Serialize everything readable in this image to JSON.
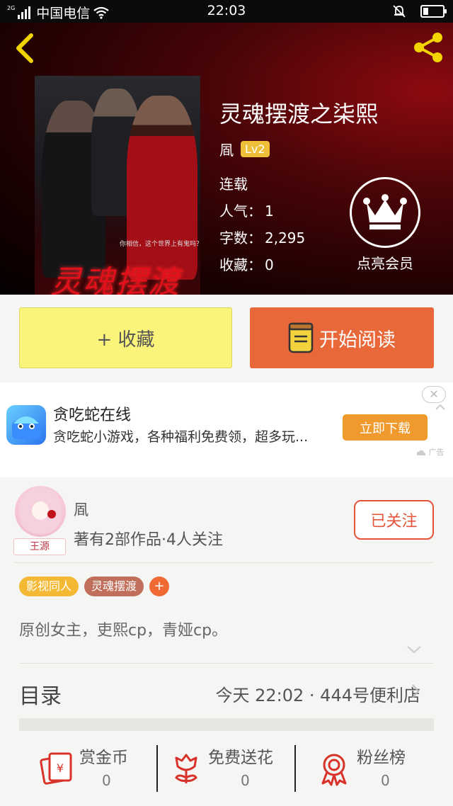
{
  "status_bar": {
    "network_tag": "2G",
    "carrier": "中国电信",
    "time": "22:03",
    "battery_level": 0.25
  },
  "hero": {
    "book_title": "灵魂摆渡之柒熙",
    "author": "凮",
    "level": "Lv2",
    "status": "连载",
    "popularity_label": "人气：",
    "popularity_value": "1",
    "word_count_label": "字数：",
    "word_count_value": "2,295",
    "favorites_label": "收藏：",
    "favorites_value": "0",
    "vip_label": "点亮会员",
    "cover": {
      "title_art": "灵魂摆渡",
      "tagline": "你相信，这个世界上有鬼吗？"
    }
  },
  "actions": {
    "collect_label": "+ 收藏",
    "read_label": "开始阅读"
  },
  "ad": {
    "title": "贪吃蛇在线",
    "description": "贪吃蛇小游戏，各种福利免费领，超多玩...",
    "download_label": "立即下载",
    "close_glyph": "✕",
    "ad_tag": "广告"
  },
  "author_section": {
    "name": "凮",
    "stats": "著有2部作品·4人关注",
    "avatar_tag": "王源",
    "follow_label": "已关注",
    "tags": [
      "影视同人",
      "灵魂摆渡"
    ],
    "add_tag": "+",
    "description": "原创女主，吏熙cp，青娅cp。"
  },
  "catalog": {
    "label": "目录",
    "latest": "今天 22:02 · 444号便利店"
  },
  "bottom_stats": [
    {
      "label": "赏金币",
      "value": "0",
      "icon": "red-envelope-icon"
    },
    {
      "label": "免费送花",
      "value": "0",
      "icon": "flower-icon"
    },
    {
      "label": "粉丝榜",
      "value": "0",
      "icon": "medal-icon"
    }
  ],
  "colors": {
    "accent_orange": "#e8683a",
    "collect_yellow": "#faf57a",
    "level_gold": "#f0bf3a",
    "follow_red": "#e6533b"
  }
}
